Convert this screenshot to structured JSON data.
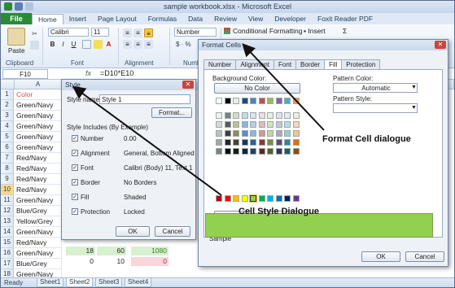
{
  "window": {
    "title": "sample workbook.xlsx - Microsoft Excel"
  },
  "ribbon": {
    "file_tab": "File",
    "tabs": [
      "Home",
      "Insert",
      "Page Layout",
      "Formulas",
      "Data",
      "Review",
      "View",
      "Developer",
      "Foxit Reader PDF"
    ],
    "active_tab": "Home",
    "font_name": "Calibri",
    "font_size": "11",
    "number_format": "Number",
    "conditional_formatting": "Conditional Formatting",
    "insert_label": "Insert",
    "paste_label": "Paste",
    "groups": {
      "clipboard": "Clipboard",
      "font": "Font",
      "alignment": "Alignment",
      "number": "Number"
    },
    "accent_file": "#2a8a3a"
  },
  "formula_bar": {
    "name_box": "F10",
    "fx": "fx",
    "formula": "=D10*E10"
  },
  "sheet": {
    "col_a": "A",
    "rows": [
      {
        "n": "1",
        "a": "Color"
      },
      {
        "n": "2",
        "a": "Green/Navy"
      },
      {
        "n": "3",
        "a": "Green/Navy"
      },
      {
        "n": "4",
        "a": "Green/Navy"
      },
      {
        "n": "5",
        "a": "Green/Navy"
      },
      {
        "n": "6",
        "a": "Green/Navy"
      },
      {
        "n": "7",
        "a": "Red/Navy"
      },
      {
        "n": "8",
        "a": "Red/Navy"
      },
      {
        "n": "9",
        "a": "Red/Navy"
      },
      {
        "n": "10",
        "a": "Red/Navy"
      },
      {
        "n": "11",
        "a": "Green/Navy"
      },
      {
        "n": "12",
        "a": "Blue/Grey"
      },
      {
        "n": "13",
        "a": "Yellow/Grey"
      },
      {
        "n": "14",
        "a": "Green/Navy"
      },
      {
        "n": "15",
        "a": "Red/Navy"
      },
      {
        "n": "16",
        "a": "Green/Navy"
      },
      {
        "n": "17",
        "a": "Blue/Grey"
      },
      {
        "n": "18",
        "a": "Green/Navy"
      }
    ],
    "row17": {
      "c": "18",
      "d": "60",
      "f": "1080"
    },
    "row18": {
      "c": "0",
      "d": "10",
      "f": "0"
    },
    "sheet_tabs": [
      "Sheet1",
      "Sheet2",
      "Sheet3",
      "Sheet4"
    ],
    "status": "Ready",
    "header_color": "#e05050"
  },
  "style_dialog": {
    "title": "Style",
    "style_name_label": "Style name:",
    "style_name_value": "Style 1",
    "format_button": "Format...",
    "includes_label": "Style Includes (By Example)",
    "options": [
      {
        "label": "Number",
        "value": "0.00"
      },
      {
        "label": "Alignment",
        "value": "General, Bottom Aligned"
      },
      {
        "label": "Font",
        "value": "Calibri (Body) 11, Text 1"
      },
      {
        "label": "Border",
        "value": "No Borders"
      },
      {
        "label": "Fill",
        "value": "Shaded"
      },
      {
        "label": "Protection",
        "value": "Locked"
      }
    ],
    "ok": "OK",
    "cancel": "Cancel"
  },
  "format_dialog": {
    "title": "Format Cells",
    "tabs": [
      "Number",
      "Alignment",
      "Font",
      "Border",
      "Fill",
      "Protection"
    ],
    "active_tab": "Fill",
    "background_color_label": "Background Color:",
    "no_color": "No Color",
    "fill_effects": "Fill Effects...",
    "more_colors": "More Colors...",
    "pattern_color_label": "Pattern Color:",
    "pattern_color_value": "Automatic",
    "pattern_style_label": "Pattern Style:",
    "sample_label": "Sample",
    "sample_color": "#92d050",
    "ok": "OK",
    "cancel": "Cancel"
  },
  "annotations": {
    "format_cell": "Format Cell dialogue",
    "cell_style": "Cell Style Dialogue"
  }
}
